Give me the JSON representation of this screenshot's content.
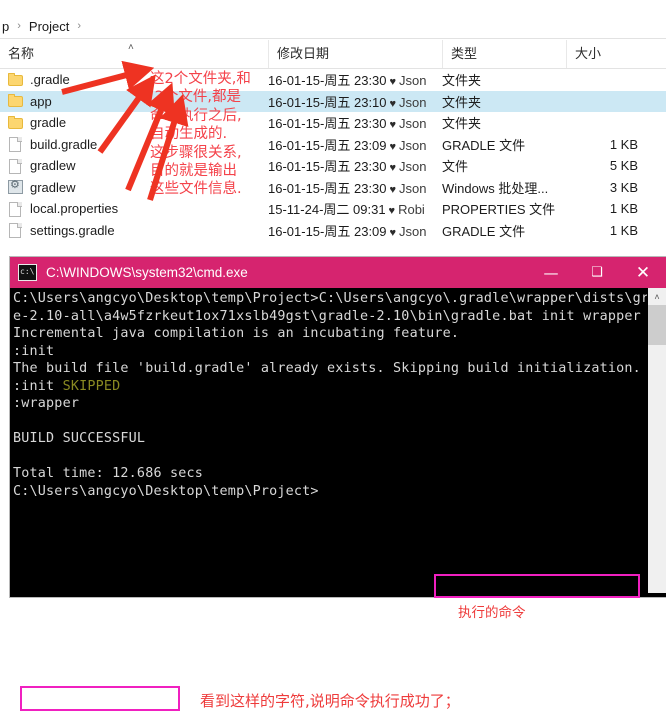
{
  "explorer": {
    "breadcrumb": {
      "items": [
        "p",
        "Project"
      ],
      "separator": "›"
    },
    "columns": [
      {
        "key": "name",
        "label": "名称"
      },
      {
        "key": "date",
        "label": "修改日期"
      },
      {
        "key": "type",
        "label": "类型"
      },
      {
        "key": "size",
        "label": "大小"
      }
    ],
    "sort_caret": "˄",
    "rows": [
      {
        "icon": "folder-icon",
        "name": ".gradle",
        "date": "16-01-15-周五 23:30",
        "owner": "Json",
        "type": "文件夹",
        "size": "",
        "selected": false
      },
      {
        "icon": "folder-icon",
        "name": "app",
        "date": "16-01-15-周五 23:10",
        "owner": "Json",
        "type": "文件夹",
        "size": "",
        "selected": true
      },
      {
        "icon": "folder-icon",
        "name": "gradle",
        "date": "16-01-15-周五 23:30",
        "owner": "Json",
        "type": "文件夹",
        "size": "",
        "selected": false
      },
      {
        "icon": "file-icon",
        "name": "build.gradle",
        "date": "16-01-15-周五 23:09",
        "owner": "Json",
        "type": "GRADLE 文件",
        "size": "1 KB",
        "selected": false
      },
      {
        "icon": "file-icon",
        "name": "gradlew",
        "date": "16-01-15-周五 23:30",
        "owner": "Json",
        "type": "文件",
        "size": "5 KB",
        "selected": false
      },
      {
        "icon": "script-icon",
        "name": "gradlew",
        "date": "16-01-15-周五 23:30",
        "owner": "Json",
        "type": "Windows 批处理...",
        "size": "3 KB",
        "selected": false
      },
      {
        "icon": "file-icon",
        "name": "local.properties",
        "date": "15-11-24-周二 09:31",
        "owner": "Robi",
        "type": "PROPERTIES 文件",
        "size": "1 KB",
        "selected": false
      },
      {
        "icon": "file-icon",
        "name": "settings.gradle",
        "date": "16-01-15-周五 23:09",
        "owner": "Json",
        "type": "GRADLE 文件",
        "size": "1 KB",
        "selected": false
      }
    ],
    "owner_heart": "♥",
    "annotation": "这2个文件夹,和\n 2个文件,都是\n命令执行之后,\n自动生成的.\n这步骤很关系,\n目的就是输出\n这些文件信息."
  },
  "cmd": {
    "title": "C:\\WINDOWS\\system32\\cmd.exe",
    "icon": "cmd-icon",
    "window_buttons": {
      "minimize": "—",
      "maximize": "❑",
      "close": "✕"
    },
    "scrollbar": {
      "up": "˄",
      "down": "˅"
    },
    "console_lines": [
      "C:\\Users\\angcyo\\Desktop\\temp\\Project>C:\\Users\\angcyo\\.gradle\\wrapper\\dists\\gradl",
      "e-2.10-all\\a4w5fzrkeut1ox71xslb49gst\\gradle-2.10\\bin\\gradle.bat init wrapper",
      "Incremental java compilation is an incubating feature.",
      ":init",
      "The build file 'build.gradle' already exists. Skipping build initialization.",
      ":init ",
      ":wrapper",
      "",
      "BUILD SUCCESSFUL",
      "",
      "Total time: 12.686 secs",
      "C:\\Users\\angcyo\\Desktop\\temp\\Project>"
    ],
    "skipped_label": "SKIPPED",
    "annotations": {
      "command": "执行的命令",
      "build": "看到这样的字符,说明命令执行成功了；"
    }
  },
  "colors": {
    "titlebar": "#d6246f",
    "highlight_row": "#cce8f4",
    "annotation_red": "#f4424a",
    "magenta_box": "#f020c0",
    "skipped": "#8a8a22",
    "arrow_red": "#ee3322"
  }
}
